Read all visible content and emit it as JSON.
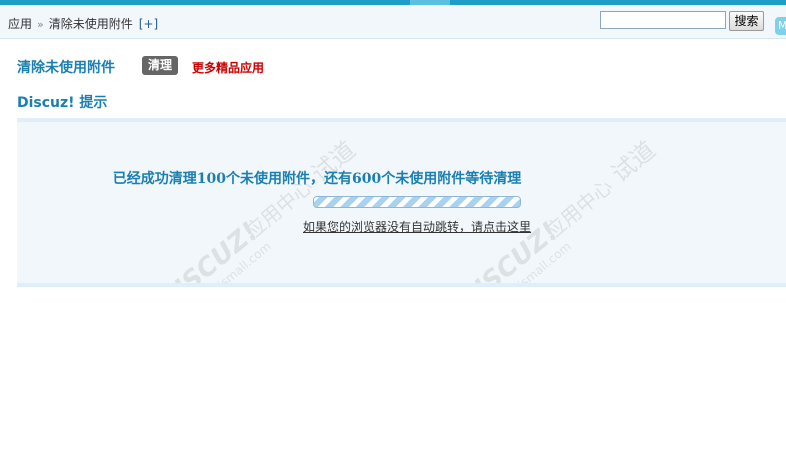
{
  "breadcrumb": {
    "items": [
      "应用",
      "清除未使用附件"
    ],
    "separator": "»",
    "add": "[+]"
  },
  "search": {
    "value": "",
    "button_label": "搜索"
  },
  "corner": {
    "label": "M"
  },
  "main": {
    "title": "清除未使用附件",
    "clean_label": "清理",
    "more_label": "更多精品应用",
    "tip_heading": "Discuz! 提示"
  },
  "message": {
    "text": "已经成功清理100个未使用附件，还有600个未使用附件等待清理",
    "redirect": "如果您的浏览器没有自动跳转，请点击这里",
    "progress": 1.0
  },
  "watermark": {
    "brand": "DISCUZ!",
    "line1": "应用中心",
    "line2": "addon.dismall.com",
    "line3": "试道"
  },
  "colors": {
    "accent": "#1b7fb0",
    "link_red": "#cc0000",
    "topbar": "#1e9dc7",
    "box_bg": "#f1f7fb"
  }
}
